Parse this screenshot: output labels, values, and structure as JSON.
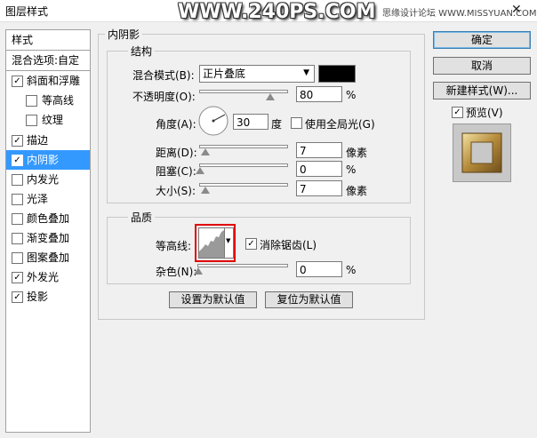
{
  "window": {
    "title": "图层样式",
    "watermark": "WWW.240PS.COM",
    "watermark_small": "思缘设计论坛 WWW.MISSYUAN.COM",
    "close_glyph": "✕"
  },
  "sidebar": {
    "header": "样式",
    "blend_options": "混合选项:自定",
    "items": [
      {
        "label": "斜面和浮雕",
        "checked": "✓"
      },
      {
        "label": "等高线",
        "checked": ""
      },
      {
        "label": "纹理",
        "checked": ""
      },
      {
        "label": "描边",
        "checked": "✓"
      },
      {
        "label": "内阴影",
        "checked": "✓"
      },
      {
        "label": "内发光",
        "checked": ""
      },
      {
        "label": "光泽",
        "checked": ""
      },
      {
        "label": "颜色叠加",
        "checked": ""
      },
      {
        "label": "渐变叠加",
        "checked": ""
      },
      {
        "label": "图案叠加",
        "checked": ""
      },
      {
        "label": "外发光",
        "checked": "✓"
      },
      {
        "label": "投影",
        "checked": "✓"
      }
    ]
  },
  "main": {
    "section_title": "内阴影",
    "structure": {
      "title": "结构",
      "blend_mode_label": "混合模式(B):",
      "blend_mode_value": "正片叠底",
      "opacity_label": "不透明度(O):",
      "opacity_value": "80",
      "opacity_unit": "%",
      "opacity_level": 0.8,
      "angle_label": "角度(A):",
      "angle_value": "30",
      "angle_unit": "度",
      "global_light_label": "使用全局光(G)",
      "distance_label": "距离(D):",
      "distance_value": "7",
      "distance_unit": "像素",
      "choke_label": "阻塞(C):",
      "choke_value": "0",
      "choke_unit": "%",
      "size_label": "大小(S):",
      "size_value": "7",
      "size_unit": "像素"
    },
    "quality": {
      "title": "品质",
      "contour_label": "等高线:",
      "antialias_label": "消除锯齿(L)",
      "antialias_checked": "✓",
      "noise_label": "杂色(N):",
      "noise_value": "0",
      "noise_unit": "%"
    },
    "set_default": "设置为默认值",
    "reset_default": "复位为默认值"
  },
  "buttons": {
    "ok": "确定",
    "cancel": "取消",
    "new_style": "新建样式(W)...",
    "preview_label": "预览(V)",
    "preview_checked": "✓"
  },
  "colors": {
    "selection": "#3399ff",
    "shadow_color": "#000000",
    "highlight_box": "#e00000"
  }
}
